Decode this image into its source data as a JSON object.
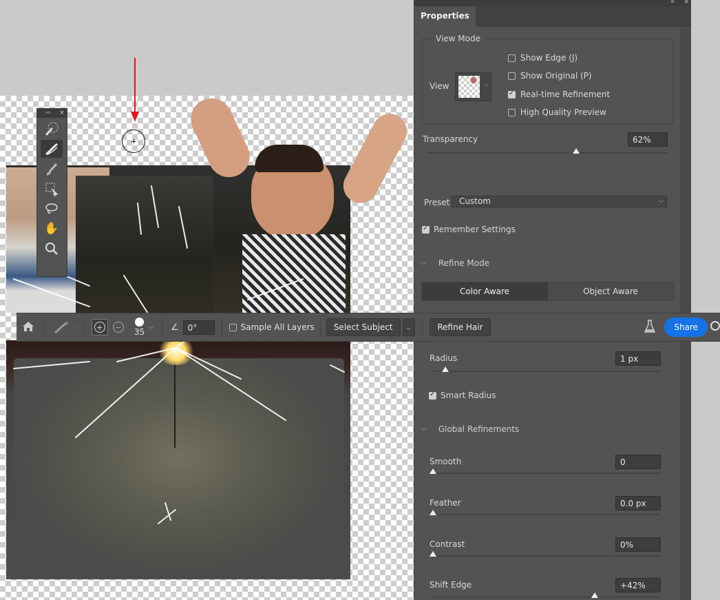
{
  "tools_panel": {
    "tools": [
      {
        "icon": "quick-selection-icon"
      },
      {
        "icon": "refine-edge-brush-icon",
        "active": true
      },
      {
        "icon": "brush-icon"
      },
      {
        "icon": "object-selection-icon"
      },
      {
        "icon": "lasso-icon"
      },
      {
        "icon": "hand-icon"
      },
      {
        "icon": "zoom-icon"
      }
    ]
  },
  "options_bar": {
    "brush_size": "35",
    "angle_value": "0°",
    "sample_all_layers_label": "Sample All Layers",
    "select_subject_label": "Select Subject",
    "refine_hair_label": "Refine Hair",
    "share_label": "Share"
  },
  "properties": {
    "tab_label": "Properties",
    "view_mode": {
      "title": "View Mode",
      "view_label": "View",
      "options": [
        {
          "label": "Show Edge (J)",
          "checked": false
        },
        {
          "label": "Show Original (P)",
          "checked": false
        },
        {
          "label": "Real-time Refinement",
          "checked": true
        },
        {
          "label": "High Quality Preview",
          "checked": false
        }
      ]
    },
    "transparency": {
      "label": "Transparency",
      "value": "62%",
      "fraction": 0.62
    },
    "preset": {
      "label": "Preset",
      "value": "Custom"
    },
    "remember_settings": {
      "label": "Remember Settings",
      "checked": true
    },
    "refine_mode": {
      "title": "Refine Mode",
      "color_aware": "Color Aware",
      "object_aware": "Object Aware",
      "selected": "Color Aware"
    },
    "edge_detection": {
      "radius": {
        "label": "Radius",
        "value": "1 px",
        "fraction": 0.05
      },
      "smart_radius": {
        "label": "Smart Radius",
        "checked": true
      }
    },
    "global_refinements": {
      "title": "Global Refinements",
      "smooth": {
        "label": "Smooth",
        "value": "0",
        "fraction": 0.0
      },
      "feather": {
        "label": "Feather",
        "value": "0.0 px",
        "fraction": 0.0
      },
      "contrast": {
        "label": "Contrast",
        "value": "0%",
        "fraction": 0.0
      },
      "shift_edge": {
        "label": "Shift Edge",
        "value": "+42%",
        "fraction": 0.71
      }
    }
  },
  "colors": {
    "share_blue": "#1473e6",
    "annotation_red": "#e8141b"
  }
}
